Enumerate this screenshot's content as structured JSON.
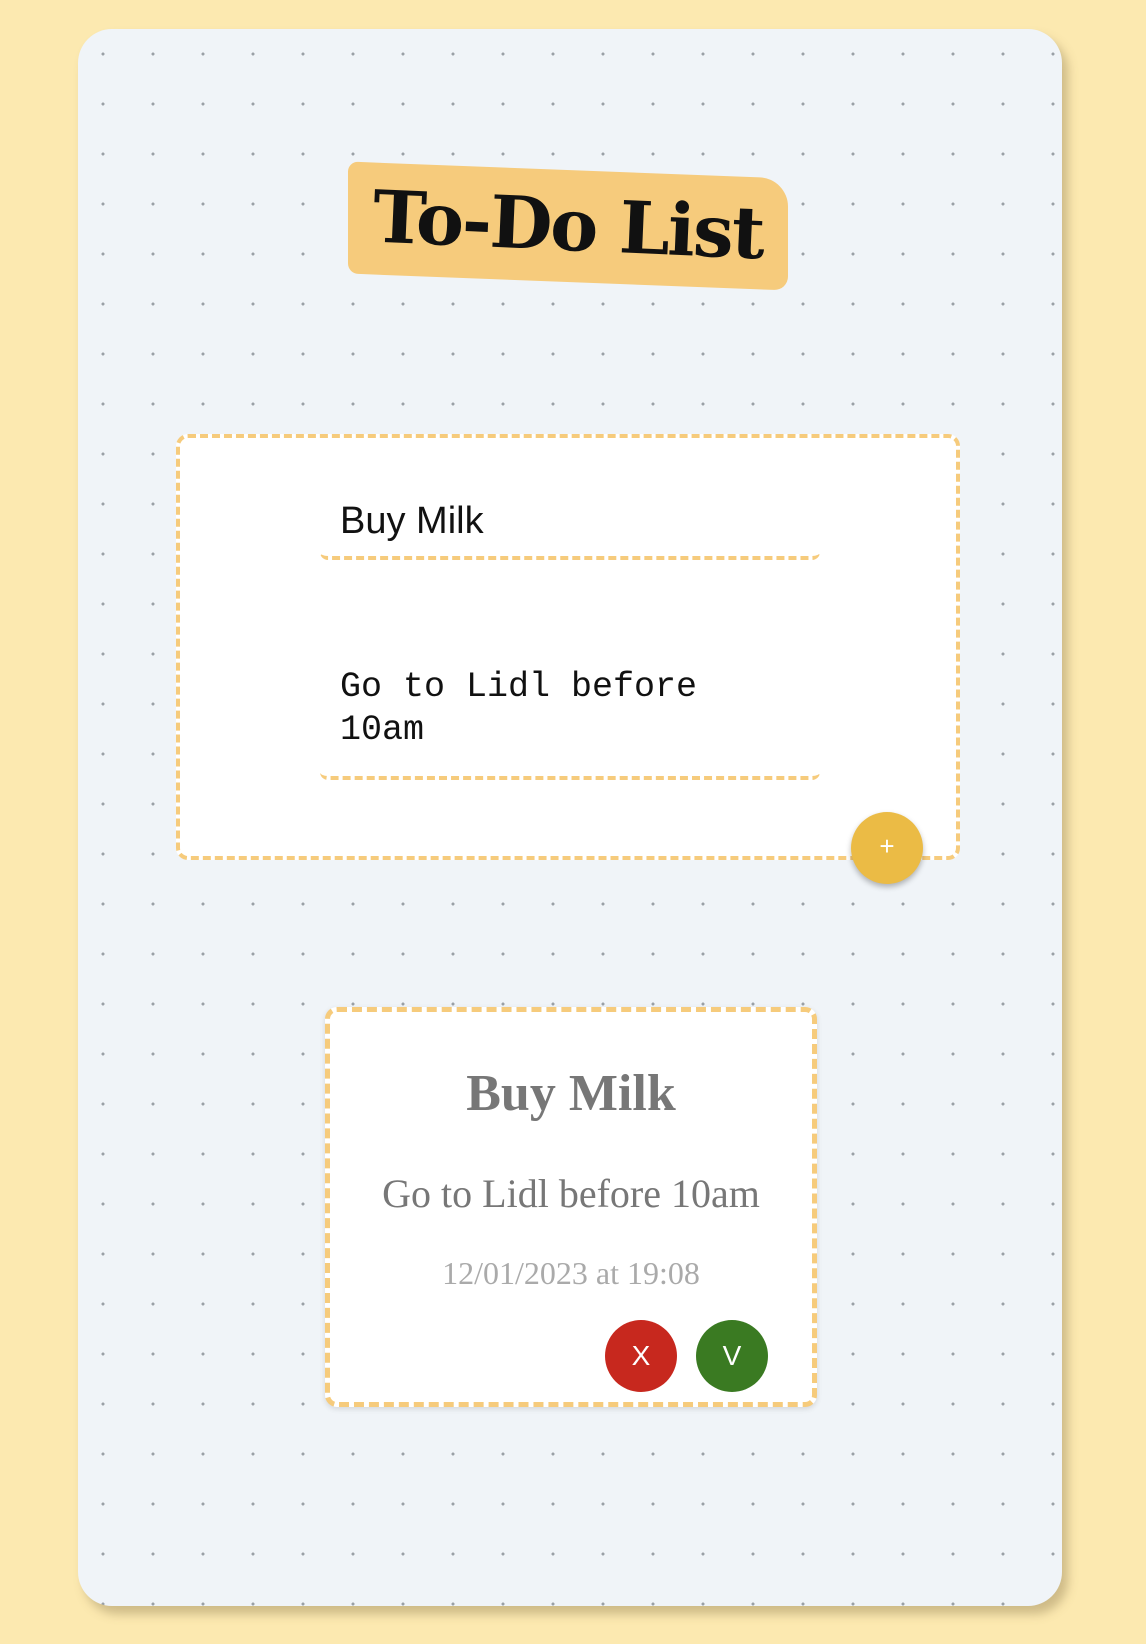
{
  "header": {
    "title": "To-Do List"
  },
  "form": {
    "title_value": "Buy Milk",
    "description_value": "Go to Lidl before\n10am",
    "add_label": "+"
  },
  "todo": {
    "title": "Buy Milk",
    "description": "Go to Lidl before 10am",
    "timestamp": "12/01/2023 at 19:08",
    "delete_label": "X",
    "done_label": "V"
  },
  "colors": {
    "background": "#fce9b0",
    "board": "#f0f4f8",
    "accent": "#f6cb7c",
    "add_button": "#ebbb45",
    "delete_button": "#c7281e",
    "done_button": "#3a7a22"
  }
}
